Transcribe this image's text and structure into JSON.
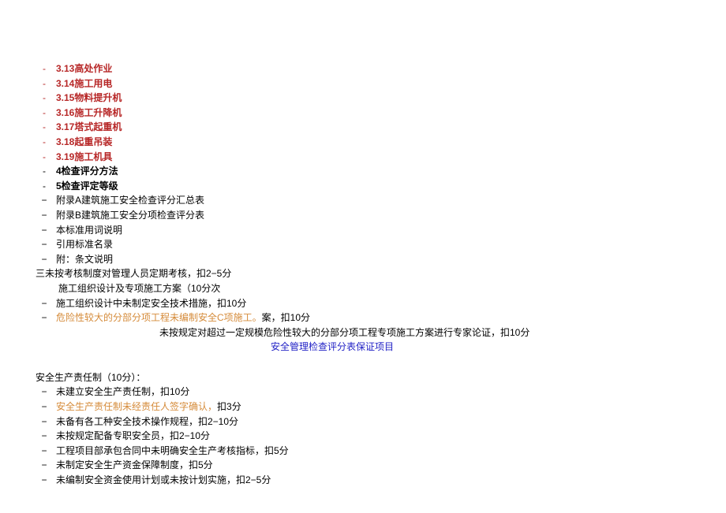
{
  "top_list": [
    {
      "bullet": "-",
      "bullet_color": "red",
      "text_color": "red",
      "text": "3.13高处作业",
      "link": true
    },
    {
      "bullet": "-",
      "bullet_color": "red",
      "text_color": "red",
      "text": "3.14施工用电",
      "link": true
    },
    {
      "bullet": "-",
      "bullet_color": "red",
      "text_color": "red",
      "text": "3.15物料提升机",
      "link": true
    },
    {
      "bullet": "-",
      "bullet_color": "red",
      "text_color": "red",
      "text": "3.16施工升降机",
      "link": true
    },
    {
      "bullet": "-",
      "bullet_color": "red",
      "text_color": "red",
      "text": "3.17塔式起重机",
      "link": true
    },
    {
      "bullet": "-",
      "bullet_color": "red",
      "text_color": "red",
      "text": "3.18起重吊装",
      "link": true
    },
    {
      "bullet": "-",
      "bullet_color": "red",
      "text_color": "red",
      "text": "3.19施工机具",
      "link": true
    },
    {
      "bullet": "-",
      "bullet_color": "black",
      "text_color": "black",
      "text": "4检查评分方法",
      "link": true
    },
    {
      "bullet": "-",
      "bullet_color": "black",
      "text_color": "black",
      "text": "5检查评定等级",
      "link": true
    },
    {
      "bullet": "−",
      "bullet_color": "black",
      "text_color": "black",
      "text": "附录A建筑施工安全检查评分汇总表",
      "link": false
    },
    {
      "bullet": "−",
      "bullet_color": "black",
      "text_color": "black",
      "text": "附录B建筑施工安全分项检查评分表",
      "link": false
    },
    {
      "bullet": "−",
      "bullet_color": "black",
      "text_color": "black",
      "text": "本标准用词说明",
      "link": false
    },
    {
      "bullet": "−",
      "bullet_color": "black",
      "text_color": "black",
      "text": "引用标准名录",
      "link": false
    },
    {
      "bullet": "−",
      "bullet_color": "black",
      "text_color": "black",
      "text": "附：条文说明",
      "link": false
    }
  ],
  "mid_block": {
    "line1": "三未按考核制度对管理人员定期考核，扣2−5分",
    "line2": "施工组织设计及专项施工方案（10分次",
    "line3": {
      "bullet": "−",
      "text": "施工组织设计中未制定安全技术措施，扣10分"
    },
    "line4": {
      "bullet": "−",
      "text_pre": "危险性较大的分部分项工程未编制安全C项施工。",
      "text_post": "案，扣10分"
    },
    "line5": "未按规定对超过一定规模危险性较大的分部分项工程专项施工方案进行专家论证，扣10分",
    "title": "安全管理检查评分表保证项目"
  },
  "section2": {
    "heading": "安全生产责任制（10分）：",
    "items": [
      {
        "bullet": "−",
        "color": "black",
        "text": "未建立安全生产责任制，扣10分"
      },
      {
        "bullet": "−",
        "color": "orange",
        "text": "安全生产责任制未经责任人签字确认，",
        "suffix": "扣3分"
      },
      {
        "bullet": "−",
        "color": "black",
        "text": "未备有各工种安全技术操作规程，扣2−10分"
      },
      {
        "bullet": "−",
        "color": "black",
        "text": "未按规定配备专职安全员，扣2−10分"
      },
      {
        "bullet": "−",
        "color": "black",
        "text": "工程项目部承包合同中未明确安全生产考核指标，扣5分"
      },
      {
        "bullet": "−",
        "color": "black",
        "text": "未制定安全生产资金保障制度，扣5分"
      },
      {
        "bullet": "−",
        "color": "black",
        "text": "未编制安全资金使用计划或未按计划实施，扣2−5分"
      }
    ]
  }
}
